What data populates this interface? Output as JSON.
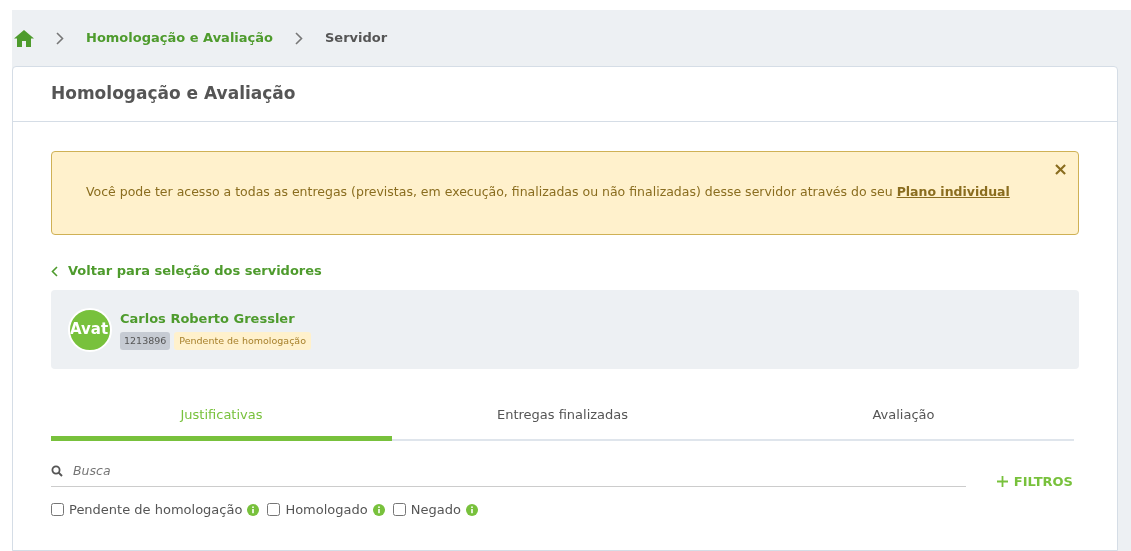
{
  "breadcrumb": [
    {
      "label": "Homologação e Avaliação",
      "kind": "link"
    },
    {
      "label": "Servidor",
      "kind": "current"
    }
  ],
  "card_title": "Homologação e Avaliação",
  "alert": {
    "text": "Você pode ter acesso a todas as entregas (previstas, em execução, finalizadas ou não finalizadas) desse servidor através do seu ",
    "link": "Plano individual",
    "close": "×"
  },
  "back_link": "Voltar para seleção dos servidores",
  "servidor": {
    "avatar_text": "Avat",
    "name": "Carlos Roberto Gressler",
    "id": "1213896",
    "status": "Pendente de homologação"
  },
  "tabs": [
    {
      "label": "Justificativas",
      "selected": true
    },
    {
      "label": "Entregas finalizadas",
      "selected": false
    },
    {
      "label": "Avaliação",
      "selected": false
    }
  ],
  "search": {
    "placeholder": "Busca"
  },
  "filters_button": "FILTROS",
  "checkboxes": [
    {
      "label": "Pendente de homologação",
      "checked": false
    },
    {
      "label": "Homologado",
      "checked": false
    },
    {
      "label": "Negado",
      "checked": false
    }
  ]
}
